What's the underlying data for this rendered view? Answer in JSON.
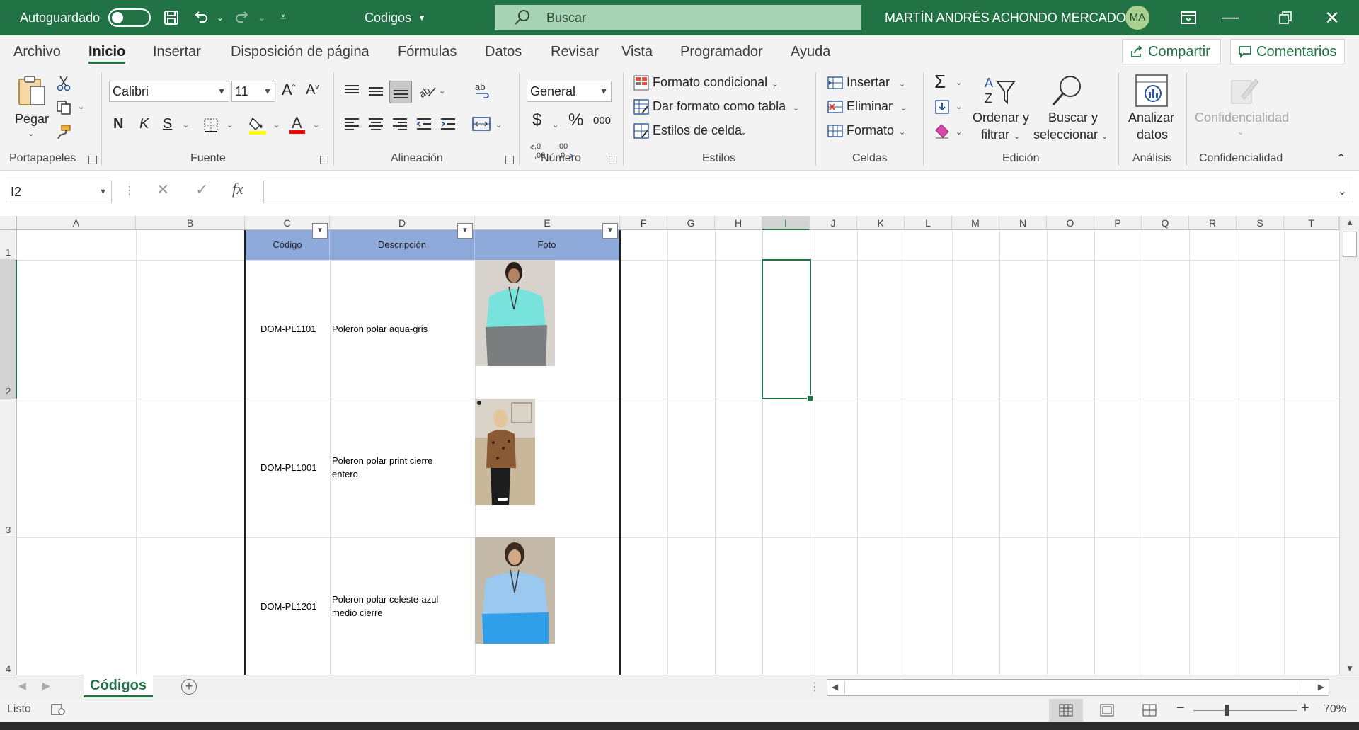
{
  "titlebar": {
    "autosave_label": "Autoguardado",
    "autosave_state": "off",
    "document_title": "Codigos",
    "search_placeholder": "Buscar",
    "user_name": "MARTÍN ANDRÉS ACHONDO MERCADO",
    "user_initials": "MA"
  },
  "menu": {
    "tabs": [
      "Archivo",
      "Inicio",
      "Insertar",
      "Disposición de página",
      "Fórmulas",
      "Datos",
      "Revisar",
      "Vista",
      "Programador",
      "Ayuda"
    ],
    "active_tab": "Inicio",
    "share_label": "Compartir",
    "comments_label": "Comentarios"
  },
  "ribbon": {
    "clipboard": {
      "paste_label": "Pegar",
      "group_label": "Portapapeles"
    },
    "font": {
      "name": "Calibri",
      "size": "11",
      "bold": "N",
      "italic": "K",
      "underline": "S",
      "group_label": "Fuente",
      "highlight_color": "#FFFF00",
      "font_color": "#FF0000"
    },
    "alignment": {
      "group_label": "Alineación"
    },
    "number": {
      "format": "General",
      "currency": "$",
      "percent": "%",
      "thousands": "000",
      "group_label": "Número"
    },
    "styles": {
      "conditional_format": "Formato condicional",
      "format_as_table": "Dar formato como tabla",
      "cell_styles": "Estilos de celda",
      "group_label": "Estilos"
    },
    "cells": {
      "insert": "Insertar",
      "delete": "Eliminar",
      "format": "Formato",
      "group_label": "Celdas"
    },
    "editing": {
      "sort_filter_line1": "Ordenar y",
      "sort_filter_line2": "filtrar",
      "find_select_line1": "Buscar y",
      "find_select_line2": "seleccionar",
      "group_label": "Edición"
    },
    "analysis": {
      "analyze_line1": "Analizar",
      "analyze_line2": "datos",
      "group_label": "Análisis"
    },
    "sensitivity": {
      "label": "Confidencialidad",
      "group_label": "Confidencialidad"
    }
  },
  "formula_bar": {
    "name_box": "I2",
    "formula": ""
  },
  "sheet": {
    "columns": [
      "A",
      "B",
      "C",
      "D",
      "E",
      "F",
      "G",
      "H",
      "I",
      "J",
      "K",
      "L",
      "M",
      "N",
      "O",
      "P",
      "Q",
      "R",
      "S",
      "T"
    ],
    "rows": [
      "1",
      "2",
      "3",
      "4"
    ],
    "selected_cell": "I2",
    "table_headers": [
      "Código",
      "Descripción",
      "Foto"
    ],
    "table_rows": [
      {
        "code": "DOM-PL1101",
        "description": "Poleron polar aqua-gris"
      },
      {
        "code": "DOM-PL1001",
        "description_line1": "Poleron polar print cierre",
        "description_line2": "entero"
      },
      {
        "code": "DOM-PL1201",
        "description_line1": "Poleron polar celeste-azul",
        "description_line2": "medio cierre"
      }
    ],
    "header_color": "#8EAADB",
    "accent_color": "#217346"
  },
  "sheet_tabs": {
    "active": "Códigos"
  },
  "status": {
    "ready": "Listo",
    "zoom": "70%"
  }
}
